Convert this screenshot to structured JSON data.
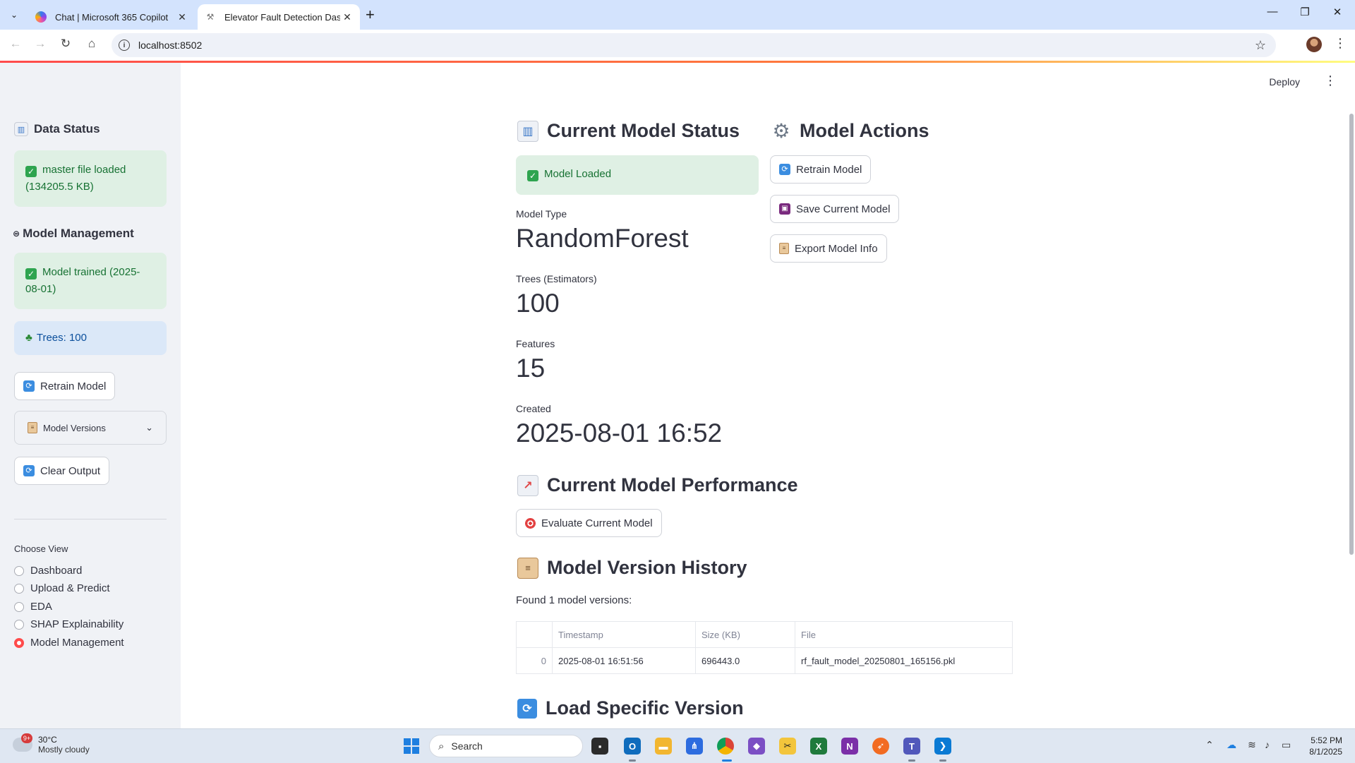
{
  "browser": {
    "tabs": [
      {
        "title": "Chat | Microsoft 365 Copilot"
      },
      {
        "title": "Elevator Fault Detection Dashbo"
      }
    ],
    "url": "localhost:8502"
  },
  "app": {
    "deploy_label": "Deploy",
    "sidebar": {
      "data_status_heading": "Data Status",
      "data_status_alert": "master file loaded (134205.5 KB)",
      "model_mgmt_heading": "Model Management",
      "model_trained_alert": "Model trained (2025-08-01)",
      "trees_alert": "Trees: 100",
      "retrain_button": "Retrain Model",
      "versions_expander": "Model Versions",
      "clear_button": "Clear Output",
      "choose_view_label": "Choose View",
      "views": [
        {
          "label": "Dashboard",
          "selected": false
        },
        {
          "label": "Upload & Predict",
          "selected": false
        },
        {
          "label": "EDA",
          "selected": false
        },
        {
          "label": "SHAP Explainability",
          "selected": false
        },
        {
          "label": "Model Management",
          "selected": true
        }
      ]
    },
    "main": {
      "status_heading": "Current Model Status",
      "status_alert": "Model Loaded",
      "metrics": [
        {
          "label": "Model Type",
          "value": "RandomForest"
        },
        {
          "label": "Trees (Estimators)",
          "value": "100"
        },
        {
          "label": "Features",
          "value": "15"
        },
        {
          "label": "Created",
          "value": "2025-08-01 16:52"
        }
      ],
      "actions_heading": "Model Actions",
      "actions": {
        "retrain": "Retrain Model",
        "save": "Save Current Model",
        "export": "Export Model Info"
      },
      "performance_heading": "Current Model Performance",
      "evaluate_button": "Evaluate Current Model",
      "history_heading": "Model Version History",
      "history_found": "Found 1 model versions:",
      "history_table": {
        "columns": [
          "",
          "Timestamp",
          "Size (KB)",
          "File"
        ],
        "rows": [
          [
            "0",
            "2025-08-01 16:51:56",
            "696443.0",
            "rf_fault_model_20250801_165156.pkl"
          ]
        ]
      },
      "load_heading": "Load Specific Version"
    }
  },
  "taskbar": {
    "weather_temp": "30°C",
    "weather_desc": "Mostly cloudy",
    "weather_badge": "9+",
    "search_placeholder": "Search",
    "time": "5:52 PM",
    "date": "8/1/2025"
  }
}
